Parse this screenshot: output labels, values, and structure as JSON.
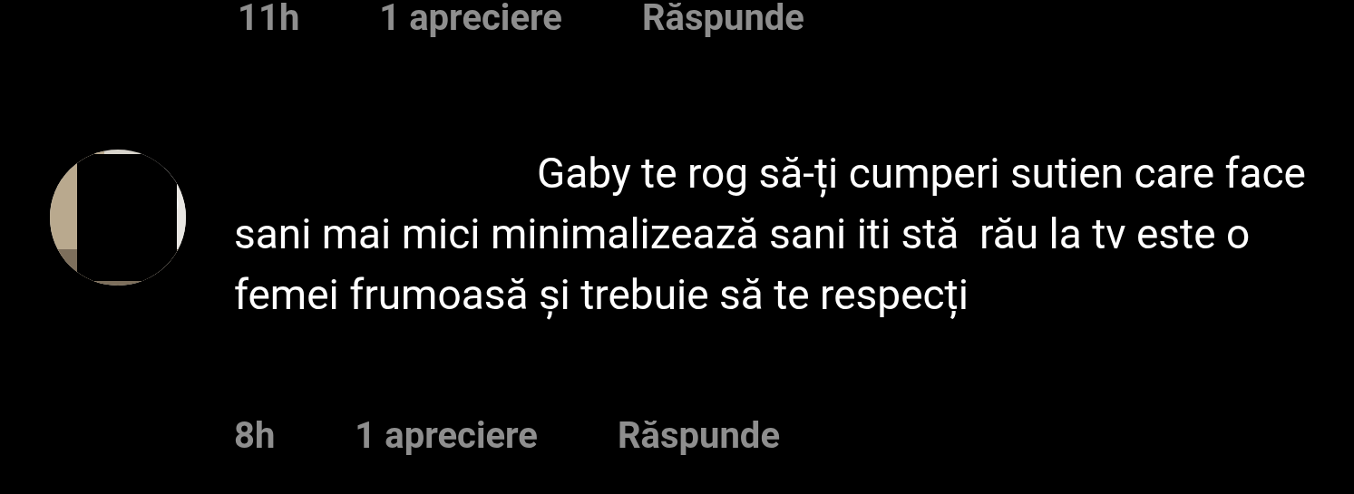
{
  "previous_comment": {
    "time": "11h",
    "likes": "1 apreciere",
    "reply": "Răspunde"
  },
  "comment": {
    "text": "Gaby te rog să-ți cumperi sutien care face sani mai mici minimalizează sani iti stă  rău la tv este o femei frumoasă și trebuie să te respecți",
    "time": "8h",
    "likes": "1 apreciere",
    "reply": "Răspunde"
  }
}
